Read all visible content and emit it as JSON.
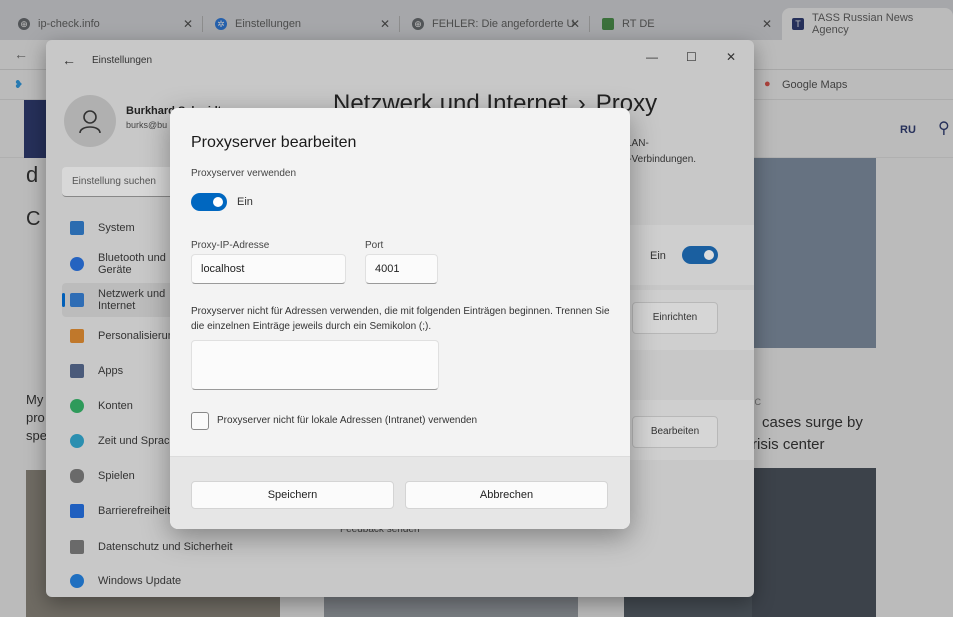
{
  "browser": {
    "tabs": [
      {
        "title": "ip-check.info",
        "color": "#5f6368"
      },
      {
        "title": "Einstellungen",
        "color": "#1a73e8"
      },
      {
        "title": "FEHLER: Die angeforderte U",
        "color": "#5f6368"
      },
      {
        "title": "RT DE",
        "color": "#3b8d3b"
      },
      {
        "title": "TASS Russian News Agency",
        "color": "#1b2a6b"
      }
    ],
    "bookmark_google_maps": "Google Maps"
  },
  "webpage": {
    "lang": "RU",
    "headline_right_1": "cases surge by",
    "headline_right_2": "risis center",
    "tag_right": "IC",
    "left_letters": [
      "T",
      "d",
      "C",
      "My",
      "pro",
      "spe"
    ],
    "feedback_text": "Feedback senden"
  },
  "settings": {
    "window_title": "Einstellungen",
    "user_name": "Burkhard Schmidt",
    "user_email": "burks@bu",
    "search_placeholder": "Einstellung suchen",
    "nav": [
      {
        "label": "System",
        "color": "#2b6cb0"
      },
      {
        "label": "Bluetooth und Geräte",
        "color": "#2563c0"
      },
      {
        "label": "Netzwerk und Internet",
        "color": "#2f6db5"
      },
      {
        "label": "Personalisierung",
        "color": "#c0782b"
      },
      {
        "label": "Apps",
        "color": "#4a5a7a"
      },
      {
        "label": "Konten",
        "color": "#2e9a5a"
      },
      {
        "label": "Zeit und Sprache",
        "color": "#2b8fb0"
      },
      {
        "label": "Spielen",
        "color": "#6a6a6a"
      },
      {
        "label": "Barrierefreiheit",
        "color": "#1f5fbf"
      },
      {
        "label": "Datenschutz und Sicherheit",
        "color": "#6a6a6a"
      },
      {
        "label": "Windows Update",
        "color": "#1f6fc0"
      }
    ],
    "page_title_main": "Netzwerk und Internet",
    "page_title_sep": "›",
    "page_title_sub": "Proxy",
    "desc_line1": "LAN-",
    "desc_line2": "i-Verbindungen.",
    "toggle_on_label": "Ein",
    "setup_button": "Einrichten",
    "edit_button": "Bearbeiten"
  },
  "dialog": {
    "title": "Proxyserver bearbeiten",
    "use_proxy_label": "Proxyserver verwenden",
    "toggle_label": "Ein",
    "ip_label": "Proxy-IP-Adresse",
    "ip_value": "localhost",
    "port_label": "Port",
    "port_value": "4001",
    "exceptions_text": "Proxyserver nicht für Adressen verwenden, die mit folgenden Einträgen beginnen. Trennen Sie die einzelnen Einträge jeweils durch ein Semikolon (;).",
    "exceptions_value": "",
    "local_checkbox_label": "Proxyserver nicht für lokale Adressen (Intranet) verwenden",
    "save_button": "Speichern",
    "cancel_button": "Abbrechen"
  }
}
